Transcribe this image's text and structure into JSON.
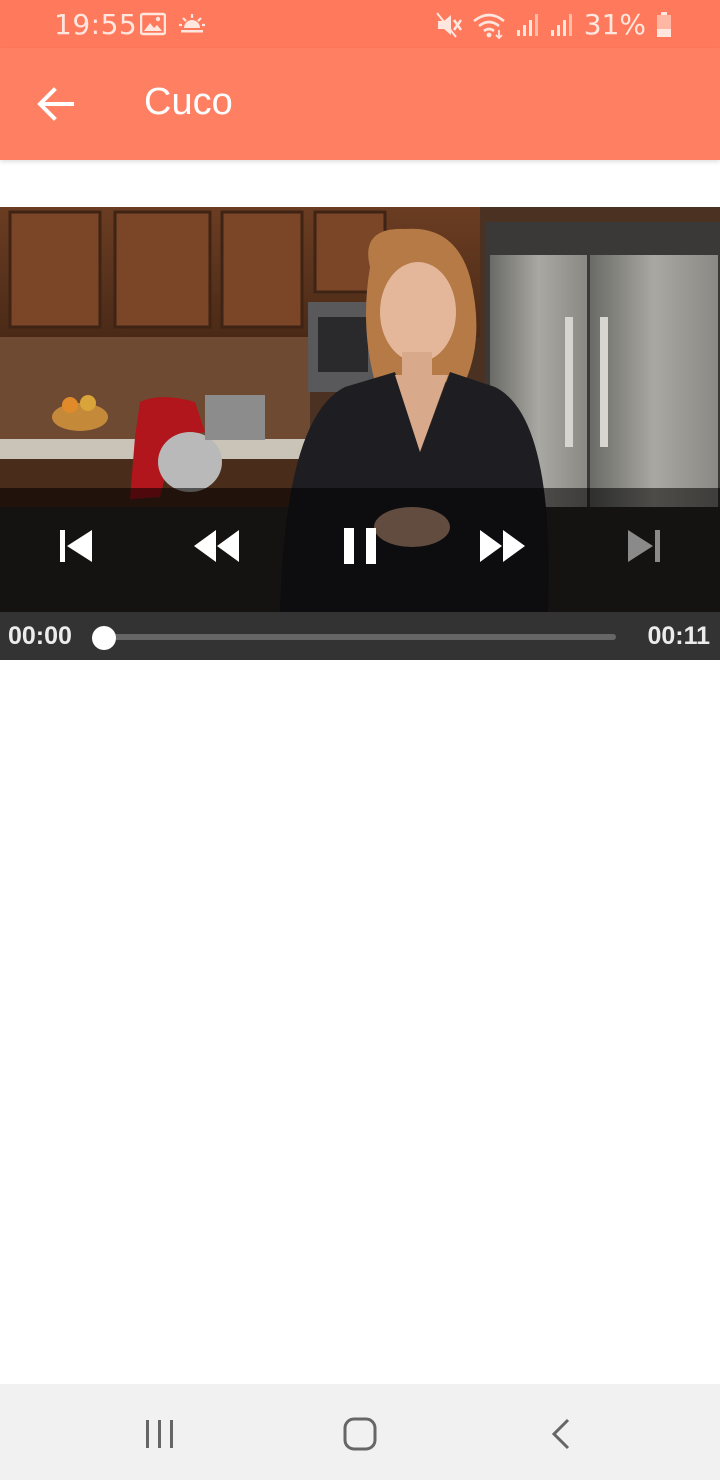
{
  "status_bar": {
    "time": "19:55",
    "battery_percent": "31%",
    "icons": [
      "image-icon",
      "weather-icon",
      "mute-icon",
      "wifi-icon",
      "signal-icon",
      "signal-icon",
      "battery-icon"
    ]
  },
  "app_bar": {
    "title": "Cuco",
    "back_icon": "arrow-back-icon",
    "color": "#ff7f62"
  },
  "player": {
    "current_time": "00:00",
    "duration": "00:11",
    "progress": 0,
    "state": "playing",
    "controls": [
      "skip-previous-icon",
      "rewind-icon",
      "pause-icon",
      "fast-forward-icon",
      "skip-next-icon"
    ]
  },
  "nav_bar": {
    "buttons": [
      "recent-apps-icon",
      "home-icon",
      "back-icon"
    ]
  }
}
